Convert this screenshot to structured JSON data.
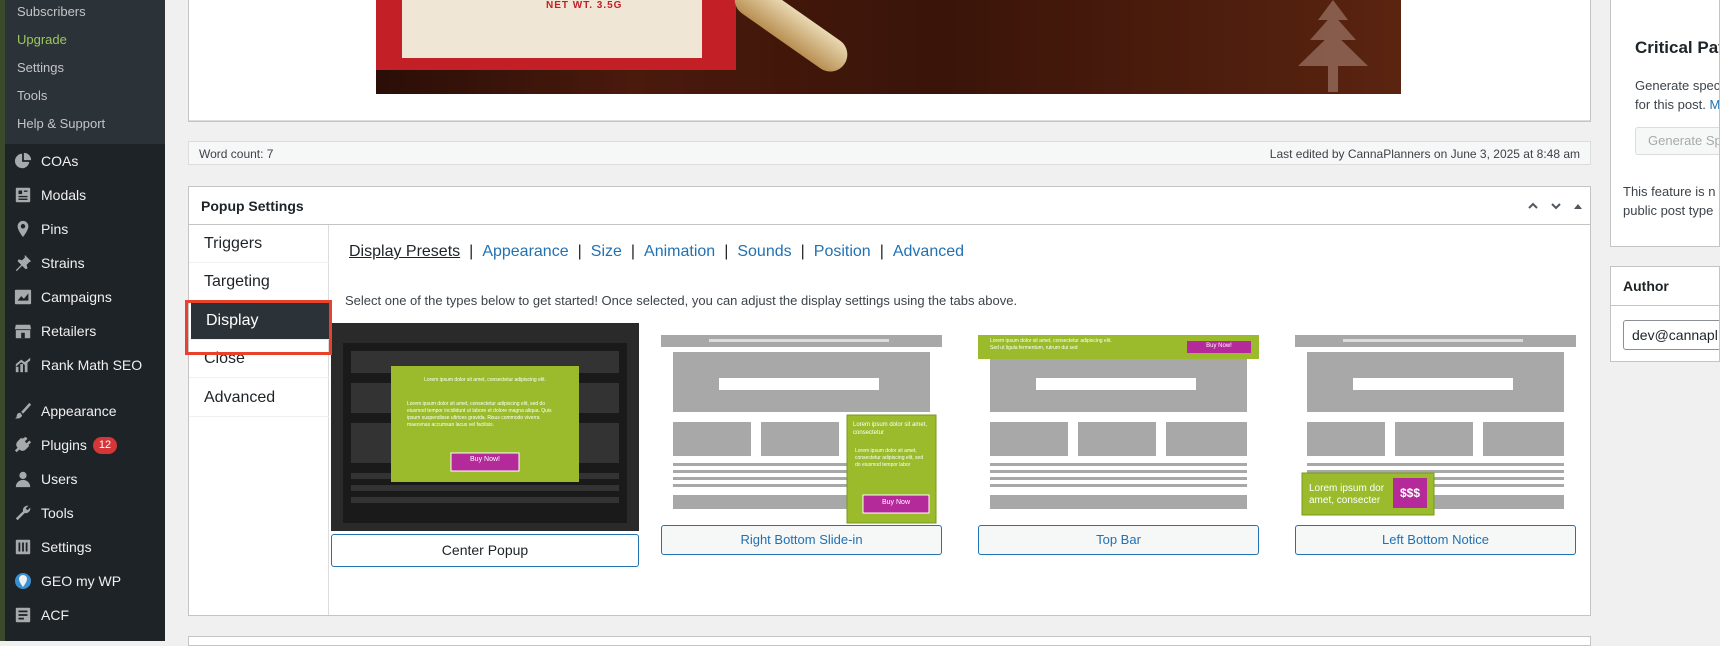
{
  "sidebar": {
    "submenu": [
      {
        "label": "Subscribers"
      },
      {
        "label": "Upgrade"
      },
      {
        "label": "Settings"
      },
      {
        "label": "Tools"
      },
      {
        "label": "Help & Support"
      }
    ],
    "items": [
      {
        "label": "COAs",
        "icon": "pie-chart-icon"
      },
      {
        "label": "Modals",
        "icon": "modals-icon"
      },
      {
        "label": "Pins",
        "icon": "pin-icon"
      },
      {
        "label": "Strains",
        "icon": "pushpin-icon"
      },
      {
        "label": "Campaigns",
        "icon": "campaigns-icon"
      },
      {
        "label": "Retailers",
        "icon": "store-icon"
      },
      {
        "label": "Rank Math SEO",
        "icon": "rank-math-icon"
      },
      {
        "label": "Appearance",
        "icon": "paintbrush-icon"
      },
      {
        "label": "Plugins",
        "icon": "plugin-icon",
        "badge": "12"
      },
      {
        "label": "Users",
        "icon": "users-icon"
      },
      {
        "label": "Tools",
        "icon": "wrench-icon"
      },
      {
        "label": "Settings",
        "icon": "settings-icon"
      },
      {
        "label": "GEO my WP",
        "icon": "geo-icon"
      },
      {
        "label": "ACF",
        "icon": "acf-icon"
      }
    ]
  },
  "editor": {
    "image_text": "NET WT. 3.5G",
    "word_count": "Word count: 7",
    "last_edited": "Last edited by CannaPlanners on June 3, 2025 at 8:48 am"
  },
  "popup_settings": {
    "title": "Popup Settings",
    "tabs": [
      {
        "label": "Triggers"
      },
      {
        "label": "Targeting"
      },
      {
        "label": "Display",
        "active": true
      },
      {
        "label": "Close"
      },
      {
        "label": "Advanced"
      }
    ],
    "subtabs": [
      {
        "label": "Display Presets",
        "current": true
      },
      {
        "label": "Appearance"
      },
      {
        "label": "Size"
      },
      {
        "label": "Animation"
      },
      {
        "label": "Sounds"
      },
      {
        "label": "Position"
      },
      {
        "label": "Advanced"
      }
    ],
    "instructions": "Select one of the types below to get started! Once selected, you can adjust the display settings using the tabs above.",
    "presets": [
      {
        "label": "Center Popup",
        "selected": true,
        "thumb_lorem_title": "Lorem ipsum dolor sit amet, consectetur adipiscing elit.",
        "thumb_lorem_body": "Lorem ipsum dolor sit amet, consectetur adipiscing elit, sed do eiusmod tempor incididunt ut labore et dolore magna aliqua. Quis ipsum suspendisse ultrices gravida. Risus commodo viverra maecenas accumsan lacus vel facilisis.",
        "thumb_button": "Buy Now!"
      },
      {
        "label": "Right Bottom Slide-in",
        "thumb_lorem_title": "Lorem ipsum dolor sit amet, consectetur",
        "thumb_lorem_body": "Lorem ipsum dolor sit amet, consectetur adipiscing elit, sed do eiusmod tempor labor",
        "thumb_button": "Buy Now"
      },
      {
        "label": "Top Bar",
        "thumb_lorem_title": "Lorem ipsum dolor sit amet, consectetur adipiscing elit.",
        "thumb_lorem_body": "Sed ut ligula fermentum, rutrum dui sed",
        "thumb_button": "Buy Now!"
      },
      {
        "label": "Left Bottom Notice",
        "thumb_lorem_title": "Lorem ipsum dor amet, consecter",
        "thumb_button": "$$$"
      }
    ]
  },
  "right_sidebar": {
    "critical_path": {
      "title": "Critical Pat",
      "desc_line1": "Generate spec",
      "desc_line2": "for this post.",
      "desc_link": "M",
      "button": "Generate Sp",
      "note_line1": "This feature is n",
      "note_line2": "public post type"
    },
    "author": {
      "title": "Author",
      "value": "dev@cannapl"
    }
  },
  "colors": {
    "sidebar_bg": "#1d2327",
    "accent_link": "#2271b1",
    "active_submenu": "#9bc85a",
    "highlight": "#e8412c",
    "badge": "#d63638",
    "popup_green": "#9bbb2c",
    "popup_magenta": "#b42a9a"
  }
}
